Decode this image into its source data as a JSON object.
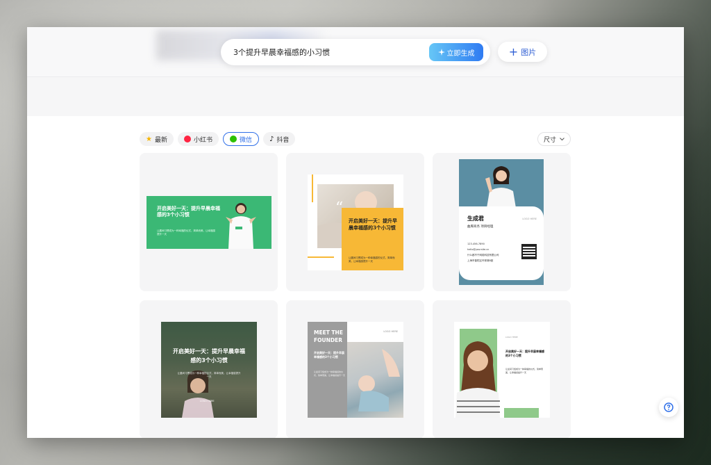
{
  "prompt": {
    "text": "3个提升早晨幸福感的小习惯",
    "generate_label": "立即生成"
  },
  "toolbar": {
    "image_label": "图片"
  },
  "tabs": [
    {
      "label": "最新",
      "icon": "star-icon",
      "active": false
    },
    {
      "label": "小红书",
      "icon": "xiaohongshu-icon",
      "active": false
    },
    {
      "label": "微信",
      "icon": "wechat-icon",
      "active": true
    },
    {
      "label": "抖音",
      "icon": "douyin-icon",
      "active": false
    }
  ],
  "size_filter": {
    "label": "尺寸"
  },
  "cards": {
    "c1": {
      "title": "开启美好一天：提升早晨幸福感的3个小习惯",
      "body": "让晨间习惯成为一种幸福的仪式，简单而美，让幸福感提升一天"
    },
    "c2": {
      "title": "开启美好一天：提升早晨幸福感的3个小习惯",
      "body": "让晨间习惯成为一种幸福感的仪式，简单而美，让幸福感提升一天"
    },
    "c3": {
      "name": "生成君",
      "role": "曲库商务 项目经理",
      "phone": "123-456-7890",
      "email": "hello@yoursite.cn",
      "company": "什么都不干网络科技有限公司",
      "address": "上海市普陀区环球港B座",
      "logo": "LOGO HERE"
    },
    "c4": {
      "title": "开启美好一天：提升早晨幸福感的3个小习惯",
      "body": "让晨间习惯成为一种幸福的仪式，简单而美，让幸福感提升一天",
      "logo": "LOGO HERE"
    },
    "c5": {
      "heading": "MEET THE FOUNDER",
      "title": "开启美好一天：提升早晨幸福感的3个小习惯",
      "body": "让晨间习惯成为一种幸福感的仪式，简单而美，让幸福感提升一天",
      "logo": "LOGO HERE"
    },
    "c6": {
      "title": "开启美好一天：提升早晨幸福感的3个小习惯",
      "body": "让晨间习惯成为一种幸福的仪式，简单而美，让幸福感提升一天",
      "logo": "LOGO HERE"
    }
  },
  "help": {
    "icon": "help-icon"
  },
  "colors": {
    "accent": "#2f6fe8",
    "green": "#3bb875",
    "yellow": "#f7b836",
    "slate": "#5b8ea3"
  }
}
